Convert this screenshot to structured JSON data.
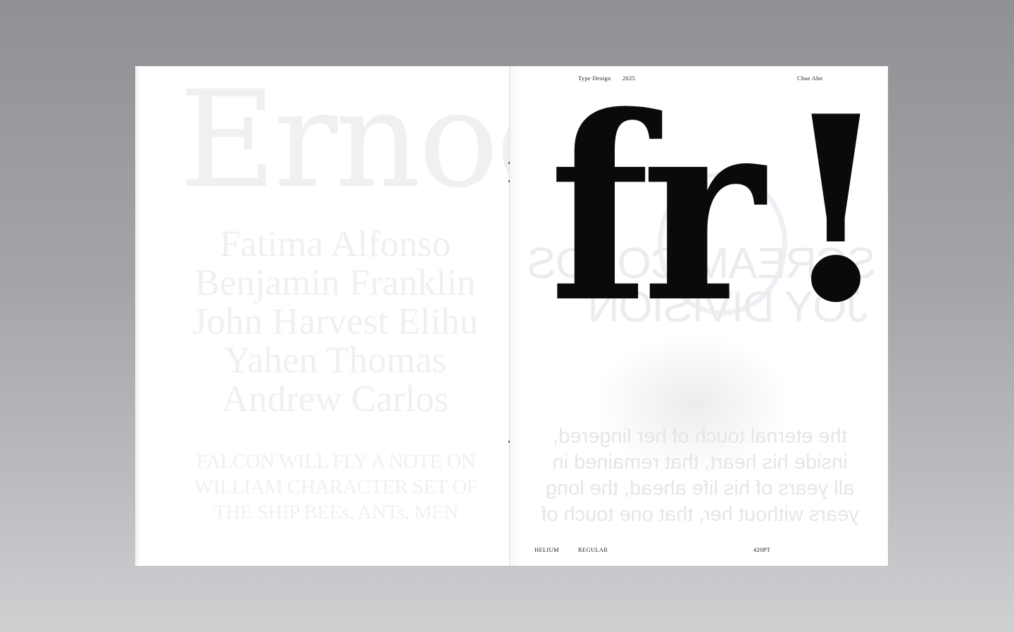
{
  "left_page": {
    "ghost_specimen": "Ernoq",
    "ghost_names": [
      "Fatima Alfonso",
      "Benjamin Franklin",
      "John Harvest Elihu",
      "Yahen Thomas",
      "Andrew Carlos"
    ],
    "ghost_caps": [
      "FALCON WILL FLY A NOTE ON",
      "WILLIAM CHARACTER SET OF",
      "THE SHIP BEEs, ANTs, MEN"
    ]
  },
  "right_page": {
    "header": {
      "title": "Type Design",
      "year": "2025",
      "author": "Chae Ahn"
    },
    "specimen_letters": "fr",
    "specimen_punct": "!",
    "ghost_title_lines": [
      "SCREAM CORDS",
      "JOY DIVISION"
    ],
    "ghost_body_lines": [
      "the eternal touch of her lingered,",
      "inside his heart, that remained in",
      "all years of his life ahead, the long",
      "years without her, that one touch of"
    ],
    "footer": {
      "font_name": "HELIUM",
      "style": "REGULAR",
      "size": "420PT"
    }
  }
}
